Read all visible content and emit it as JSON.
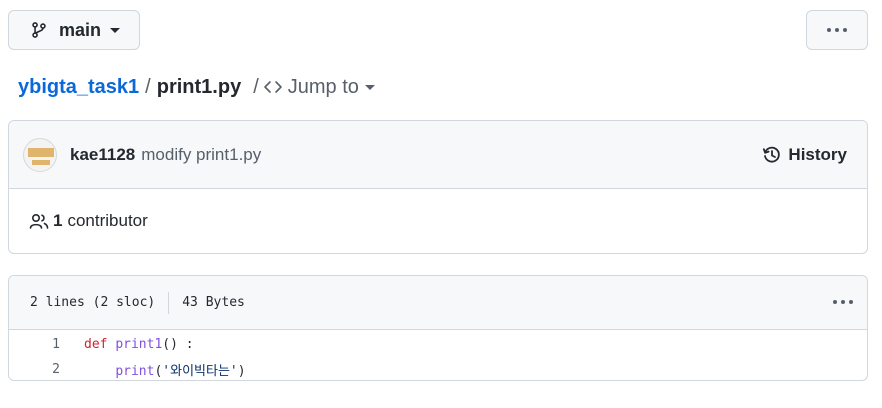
{
  "branch": {
    "name": "main",
    "icon": "git-branch-icon"
  },
  "breadcrumb": {
    "repo": "ybigta_task1",
    "separator": "/",
    "file": "print1.py",
    "separator2": "/",
    "jump_label": "Jump to",
    "jump_icon": "code-icon"
  },
  "commit": {
    "author": "kae1128",
    "message": "modify print1.py",
    "history_label": "History",
    "contributor_count": "1",
    "contributor_label": "contributor"
  },
  "file": {
    "lines_info": "2 lines (2 sloc)",
    "size": "43 Bytes",
    "code": [
      {
        "num": "1",
        "tokens": [
          {
            "t": "def",
            "c": "kw"
          },
          {
            "t": " ",
            "c": ""
          },
          {
            "t": "print1",
            "c": "fn"
          },
          {
            "t": "() :",
            "c": ""
          }
        ]
      },
      {
        "num": "2",
        "tokens": [
          {
            "t": "    ",
            "c": ""
          },
          {
            "t": "print",
            "c": "fn"
          },
          {
            "t": "(",
            "c": ""
          },
          {
            "t": "'와이빅타는'",
            "c": "str"
          },
          {
            "t": ")",
            "c": ""
          }
        ]
      }
    ]
  },
  "colors": {
    "link": "#0969da",
    "keyword": "#cf222e",
    "function": "#8250df",
    "string": "#0a3069"
  }
}
